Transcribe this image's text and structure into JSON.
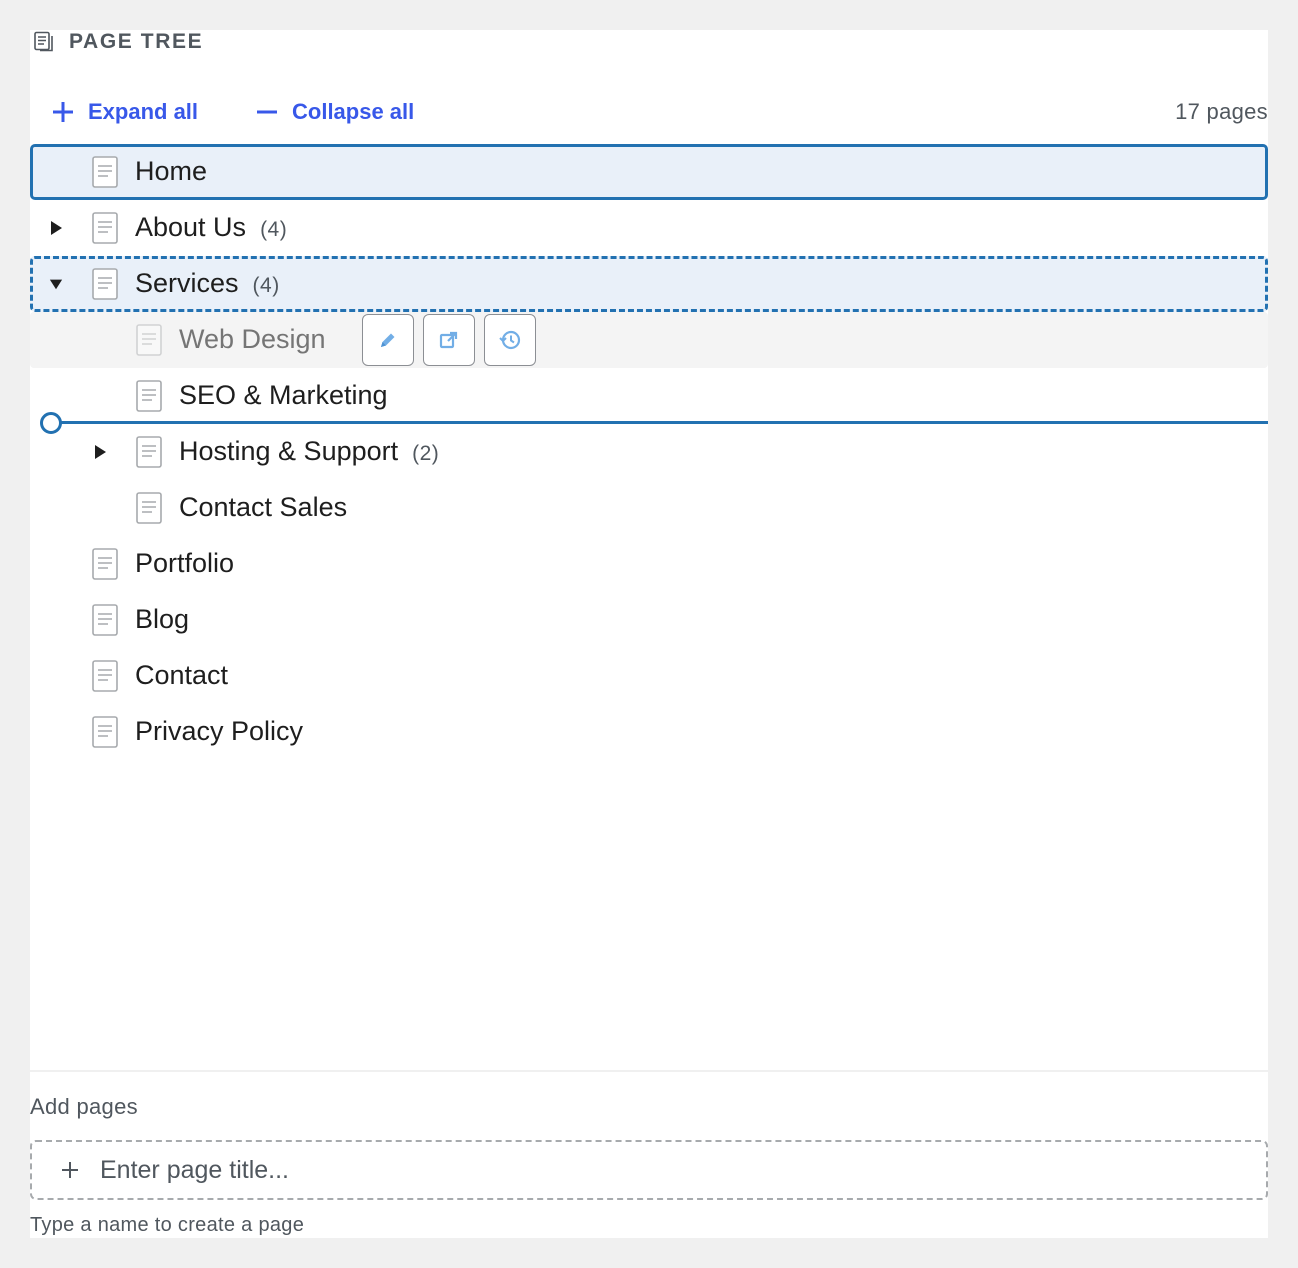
{
  "header": {
    "title": "PAGE TREE",
    "icon": "pages-icon"
  },
  "toolbar": {
    "expand_label": "Expand all",
    "collapse_label": "Collapse all",
    "page_count": "17 pages"
  },
  "tree": {
    "items": [
      {
        "label": "Home",
        "count": "",
        "level": 0,
        "state": "selected",
        "toggle": "none"
      },
      {
        "label": "About Us",
        "count": "(4)",
        "level": 0,
        "state": "normal",
        "toggle": "collapsed"
      },
      {
        "label": "Services",
        "count": "(4)",
        "level": 0,
        "state": "drop-target",
        "toggle": "expanded"
      },
      {
        "label": "Web Design",
        "count": "",
        "level": 1,
        "state": "dragging",
        "toggle": "none"
      },
      {
        "label": "SEO & Marketing",
        "count": "",
        "level": 1,
        "state": "normal",
        "toggle": "none"
      },
      {
        "label": "Hosting & Support",
        "count": "(2)",
        "level": 1,
        "state": "normal",
        "toggle": "collapsed"
      },
      {
        "label": "Contact Sales",
        "count": "",
        "level": 1,
        "state": "normal",
        "toggle": "none"
      },
      {
        "label": "Portfolio",
        "count": "",
        "level": 0,
        "state": "normal",
        "toggle": "none"
      },
      {
        "label": "Blog",
        "count": "",
        "level": 0,
        "state": "normal",
        "toggle": "none"
      },
      {
        "label": "Contact",
        "count": "",
        "level": 0,
        "state": "normal",
        "toggle": "none"
      },
      {
        "label": "Privacy Policy",
        "count": "",
        "level": 0,
        "state": "normal",
        "toggle": "none"
      }
    ],
    "row_actions": [
      "edit-icon",
      "external-link-icon",
      "history-icon"
    ]
  },
  "add": {
    "label": "Add pages",
    "placeholder": "Enter page title...",
    "hint": "Type a name to create a page"
  },
  "colors": {
    "accent": "#2271b1",
    "link": "#3858e9",
    "selected_bg": "#e9f0f9"
  }
}
